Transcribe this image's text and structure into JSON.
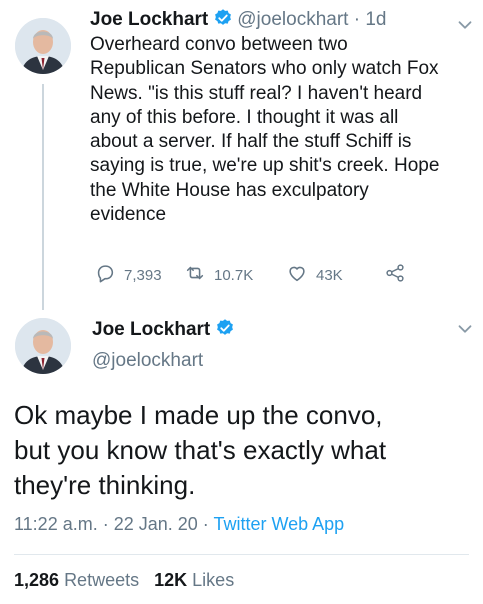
{
  "tweet1": {
    "author_name": "Joe Lockhart",
    "author_handle": "@joelockhart",
    "time_sep": " · ",
    "time_ago": "1d",
    "text": "Overheard convo between two\nRepublican Senators who only watch Fox\nNews. \"is this stuff real? I haven't heard\nany of this before. I thought it was all\nabout a server.  If half the stuff Schiff is\nsaying is true, we're up shit's creek. Hope\nthe White House has exculpatory\nevidence",
    "replies": "7,393",
    "retweets": "10.7K",
    "likes": "43K"
  },
  "tweet2": {
    "author_name": "Joe Lockhart",
    "author_handle": "@joelockhart",
    "text": "Ok maybe I made up the convo,\nbut you know that's exactly what\nthey're thinking.",
    "time": "11:22 a.m.",
    "sep1": " · ",
    "date": "22 Jan. 20",
    "sep2": " · ",
    "source": "Twitter Web App",
    "retweets_count": "1,286",
    "retweets_label": "Retweets",
    "likes_count": "12K",
    "likes_label": "Likes"
  },
  "colors": {
    "accent": "#1da1f2",
    "secondary_text": "#657786",
    "primary_text": "#14171a"
  },
  "icons": [
    "verified-badge-icon",
    "chevron-down-icon",
    "reply-icon",
    "retweet-icon",
    "like-icon",
    "share-icon"
  ]
}
